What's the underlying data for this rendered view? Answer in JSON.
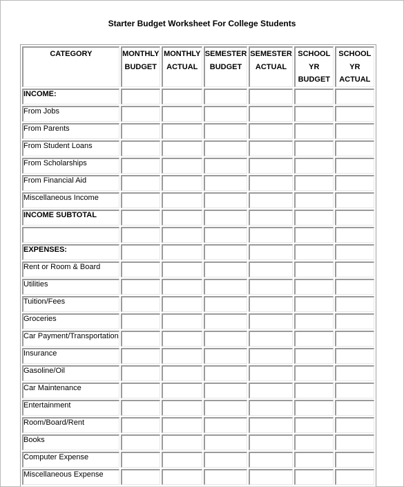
{
  "document": {
    "title": "Starter Budget Worksheet For College Students"
  },
  "table": {
    "headers": [
      {
        "lines": [
          "CATEGORY"
        ]
      },
      {
        "lines": [
          "MONTHLY",
          "BUDGET"
        ]
      },
      {
        "lines": [
          "MONTHLY",
          "ACTUAL"
        ]
      },
      {
        "lines": [
          "SEMESTER",
          "BUDGET"
        ]
      },
      {
        "lines": [
          "SEMESTER",
          "ACTUAL"
        ]
      },
      {
        "lines": [
          "SCHOOL",
          "YR",
          "BUDGET"
        ]
      },
      {
        "lines": [
          "SCHOOL",
          "YR",
          "ACTUAL"
        ]
      }
    ],
    "rows": [
      {
        "label": "INCOME:",
        "bold": true
      },
      {
        "label": "From Jobs",
        "bold": false
      },
      {
        "label": "From Parents",
        "bold": false
      },
      {
        "label": "From Student Loans",
        "bold": false
      },
      {
        "label": "From Scholarships",
        "bold": false
      },
      {
        "label": "From Financial Aid",
        "bold": false
      },
      {
        "label": "Miscellaneous Income",
        "bold": false
      },
      {
        "label": "INCOME SUBTOTAL",
        "bold": true
      },
      {
        "label": "",
        "bold": false
      },
      {
        "label": "EXPENSES:",
        "bold": true
      },
      {
        "label": "Rent or Room & Board",
        "bold": false
      },
      {
        "label": "Utilities",
        "bold": false
      },
      {
        "label": "Tuition/Fees",
        "bold": false
      },
      {
        "label": "Groceries",
        "bold": false
      },
      {
        "label": "Car Payment/Transportation",
        "bold": false
      },
      {
        "label": "Insurance",
        "bold": false
      },
      {
        "label": "Gasoline/Oil",
        "bold": false
      },
      {
        "label": "Car Maintenance",
        "bold": false
      },
      {
        "label": "Entertainment",
        "bold": false
      },
      {
        "label": "Room/Board/Rent",
        "bold": false
      },
      {
        "label": "Books",
        "bold": false
      },
      {
        "label": "Computer Expense",
        "bold": false
      },
      {
        "label": "Miscellaneous Expense",
        "bold": false
      }
    ]
  }
}
